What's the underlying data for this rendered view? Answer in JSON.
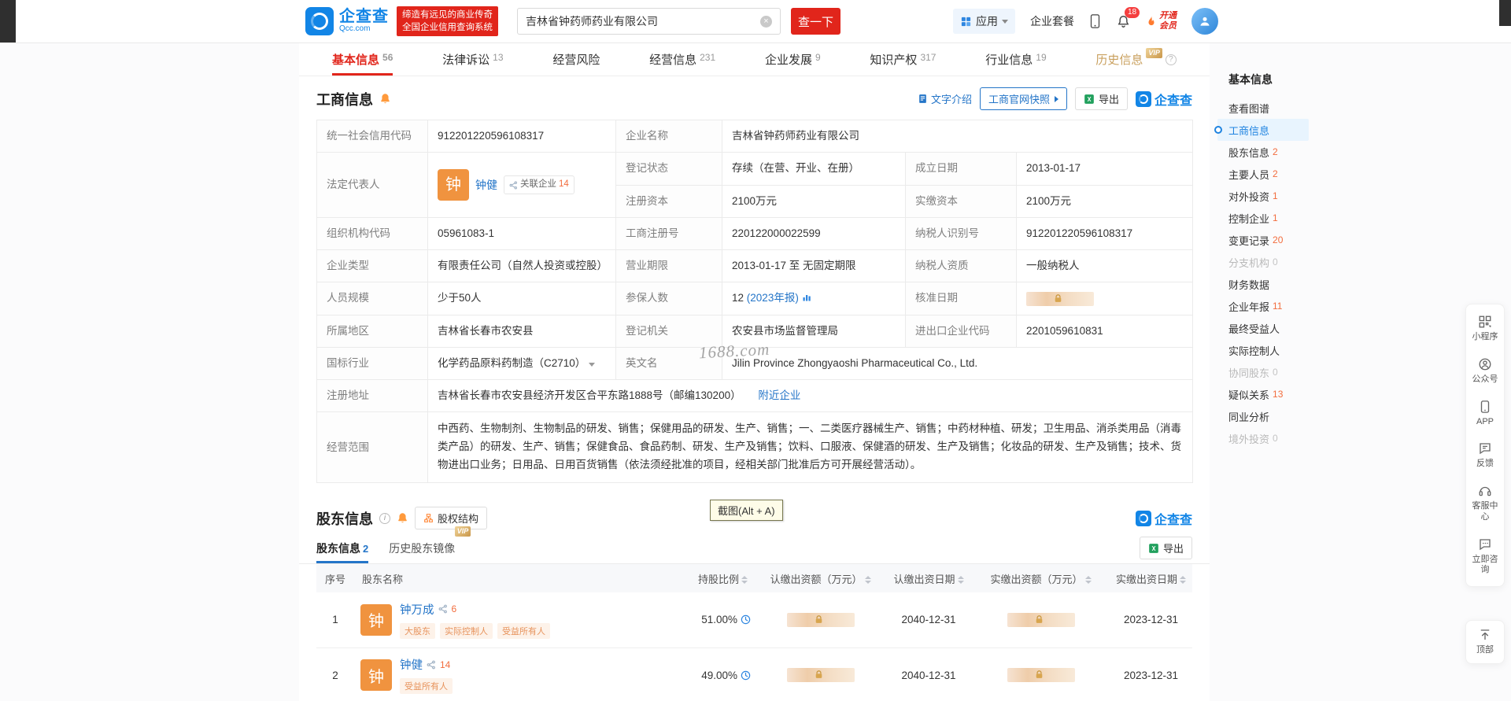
{
  "header": {
    "brand": "企查查",
    "brand_domain": "Qcc.com",
    "slogan_line1": "缔造有远见的商业传奇",
    "slogan_line2": "全国企业信用查询系统",
    "search_value": "吉林省钟药师药业有限公司",
    "search_button": "查一下",
    "nav_apps": "应用",
    "nav_package": "企业套餐",
    "notification_count": "18",
    "vip_open_line1": "开通",
    "vip_open_line2": "会员"
  },
  "tabs": [
    {
      "label": "基本信息",
      "count": "56"
    },
    {
      "label": "法律诉讼",
      "count": "13"
    },
    {
      "label": "经营风险",
      "count": ""
    },
    {
      "label": "经营信息",
      "count": "231"
    },
    {
      "label": "企业发展",
      "count": "9"
    },
    {
      "label": "知识产权",
      "count": "317"
    },
    {
      "label": "行业信息",
      "count": "19"
    },
    {
      "label": "历史信息",
      "count": ""
    }
  ],
  "vip_label": "VIP",
  "business": {
    "title": "工商信息",
    "action_intro": "文字介绍",
    "action_snapshot": "工商官网快照",
    "action_export": "导出",
    "logo_text": "企查查",
    "credit_code_label": "统一社会信用代码",
    "credit_code": "912201220596108317",
    "company_name_label": "企业名称",
    "company_name": "吉林省钟药师药业有限公司",
    "legal_rep_label": "法定代表人",
    "legal_rep_avatar": "钟",
    "legal_rep_name": "钟健",
    "legal_rep_related_label": "关联企业",
    "legal_rep_related_count": "14",
    "reg_status_label": "登记状态",
    "reg_status": "存续（在营、开业、在册）",
    "est_date_label": "成立日期",
    "est_date": "2013-01-17",
    "reg_capital_label": "注册资本",
    "reg_capital": "2100万元",
    "paid_capital_label": "实缴资本",
    "paid_capital": "2100万元",
    "org_code_label": "组织机构代码",
    "org_code": "05961083-1",
    "reg_no_label": "工商注册号",
    "reg_no": "220122000022599",
    "taxpayer_id_label": "纳税人识别号",
    "taxpayer_id": "912201220596108317",
    "company_type_label": "企业类型",
    "company_type": "有限责任公司（自然人投资或控股）",
    "term_label": "营业期限",
    "term": "2013-01-17 至 无固定期限",
    "taxpayer_quality_label": "纳税人资质",
    "taxpayer_quality": "一般纳税人",
    "staff_size_label": "人员规模",
    "staff_size": "少于50人",
    "insured_label": "参保人数",
    "insured_count": "12",
    "insured_report": "(2023年报)",
    "approval_date_label": "核准日期",
    "region_label": "所属地区",
    "region": "吉林省长春市农安县",
    "authority_label": "登记机关",
    "authority": "农安县市场监督管理局",
    "import_export_code_label": "进出口企业代码",
    "import_export_code": "2201059610831",
    "industry_label": "国标行业",
    "industry": "化学药品原料药制造（C2710）",
    "en_name_label": "英文名",
    "en_name": "Jilin Province Zhongyaoshi Pharmaceutical Co., Ltd.",
    "address_label": "注册地址",
    "address": "吉林省长春市农安县经济开发区合平东路1888号（邮编130200）",
    "nearby_link": "附近企业",
    "scope_label": "经营范围",
    "scope": "中西药、生物制剂、生物制品的研发、销售；保健用品的研发、生产、销售；一、二类医疗器械生产、销售；中药材种植、研发；卫生用品、消杀类用品（消毒类产品）的研发、生产、销售；保健食品、食品药制、研发、生产及销售；饮料、口服液、保健酒的研发、生产及销售；化妆品的研发、生产及销售；技术、货物进出口业务；日用品、日用百货销售（依法须经批准的项目，经相关部门批准后方可开展经营活动）。"
  },
  "shareholders": {
    "title": "股东信息",
    "structure_button": "股权结构",
    "tab_current": "股东信息",
    "tab_current_count": "2",
    "tab_history": "历史股东镜像",
    "export": "导出",
    "logo_text": "企查查",
    "columns": [
      "序号",
      "股东名称",
      "持股比例",
      "认缴出资额（万元）",
      "认缴出资日期",
      "实缴出资额（万元）",
      "实缴出资日期"
    ],
    "rows": [
      {
        "no": "1",
        "avatar": "钟",
        "name": "钟万成",
        "related_count": "6",
        "tags": [
          "大股东",
          "实际控制人",
          "受益所有人"
        ],
        "ratio": "51.00%",
        "subscribed_date": "2040-12-31",
        "paid_date": "2023-12-31"
      },
      {
        "no": "2",
        "avatar": "钟",
        "name": "钟健",
        "related_count": "14",
        "tags": [
          "受益所有人"
        ],
        "ratio": "49.00%",
        "subscribed_date": "2040-12-31",
        "paid_date": "2023-12-31"
      }
    ]
  },
  "anchor_nav": {
    "title": "基本信息",
    "items": [
      {
        "label": "查看图谱",
        "count": ""
      },
      {
        "label": "工商信息",
        "count": ""
      },
      {
        "label": "股东信息",
        "count": "2"
      },
      {
        "label": "主要人员",
        "count": "2"
      },
      {
        "label": "对外投资",
        "count": "1"
      },
      {
        "label": "控制企业",
        "count": "1"
      },
      {
        "label": "变更记录",
        "count": "20"
      },
      {
        "label": "分支机构",
        "count": "0"
      },
      {
        "label": "财务数据",
        "count": ""
      },
      {
        "label": "企业年报",
        "count": "11"
      },
      {
        "label": "最终受益人",
        "count": ""
      },
      {
        "label": "实际控制人",
        "count": ""
      },
      {
        "label": "协同股东",
        "count": "0"
      },
      {
        "label": "疑似关系",
        "count": "13"
      },
      {
        "label": "同业分析",
        "count": ""
      },
      {
        "label": "境外投资",
        "count": "0"
      }
    ]
  },
  "toolbar": {
    "items": [
      "小程序",
      "公众号",
      "APP",
      "反馈",
      "客服中心",
      "立即咨询"
    ],
    "top": "顶部"
  },
  "overlay": {
    "screenshot_tip": "截图(Alt + A)",
    "watermark": "1688.com"
  }
}
